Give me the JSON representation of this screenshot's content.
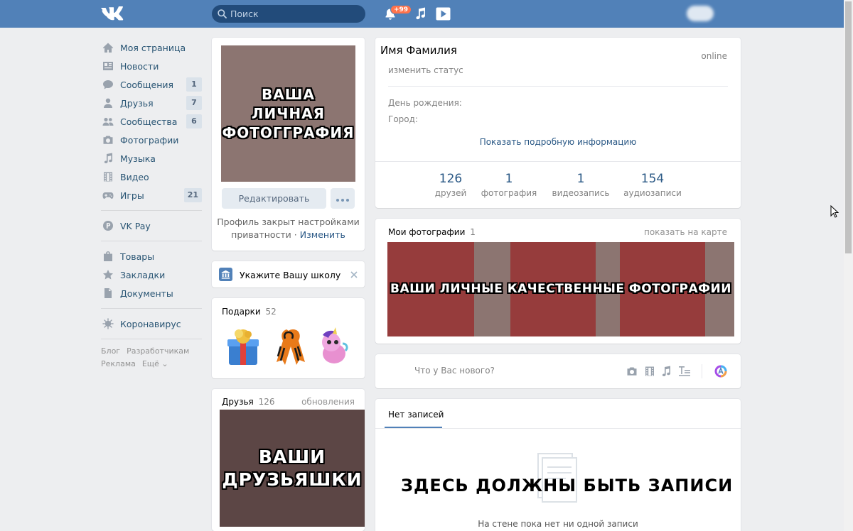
{
  "header": {
    "search_placeholder": "Поиск",
    "notifications_badge": "+99"
  },
  "menu": {
    "items": [
      {
        "label": "Моя страница",
        "icon": "home-icon",
        "count": ""
      },
      {
        "label": "Новости",
        "icon": "news-icon",
        "count": ""
      },
      {
        "label": "Сообщения",
        "icon": "messages-icon",
        "count": "1"
      },
      {
        "label": "Друзья",
        "icon": "friends-icon",
        "count": "7"
      },
      {
        "label": "Сообщества",
        "icon": "communities-icon",
        "count": "6"
      },
      {
        "label": "Фотографии",
        "icon": "camera-icon",
        "count": ""
      },
      {
        "label": "Музыка",
        "icon": "music-icon",
        "count": ""
      },
      {
        "label": "Видео",
        "icon": "video-icon",
        "count": ""
      },
      {
        "label": "Игры",
        "icon": "gamepad-icon",
        "count": "21"
      }
    ],
    "pay": "VK Pay",
    "items2": [
      {
        "label": "Товары",
        "icon": "bag-icon"
      },
      {
        "label": "Закладки",
        "icon": "star-icon"
      },
      {
        "label": "Документы",
        "icon": "document-icon"
      }
    ],
    "covid": "Коронавирус",
    "footer": [
      "Блог",
      "Разработчикам",
      "Реклама",
      "Ещё ⌄"
    ]
  },
  "profile_photo": {
    "caption_lines": [
      "ВАША",
      "ЛИЧНАЯ",
      "ФОТОГГРАФИЯ"
    ],
    "edit_label": "Редактировать",
    "privacy_text": "Профиль закрыт настройками приватности",
    "privacy_sep": "·",
    "privacy_link": "Изменить"
  },
  "school": {
    "label": "Укажите Вашу школу"
  },
  "gifts": {
    "title": "Подарки",
    "count": "52"
  },
  "friends_block": {
    "title": "Друзья",
    "count": "126",
    "updates": "обновления",
    "caption_lines": [
      "ВАШИ",
      "ДРУЗЬЯШКИ"
    ]
  },
  "profile": {
    "name": "Имя Фамилия",
    "online": "online",
    "status": "изменить статус",
    "birthday_label": "День рождения:",
    "city_label": "Город:",
    "more_info": "Показать подробную информацию",
    "stats": [
      {
        "num": "126",
        "label": "друзей"
      },
      {
        "num": "1",
        "label": "фотография"
      },
      {
        "num": "1",
        "label": "видеозапись"
      },
      {
        "num": "154",
        "label": "аудиозаписи"
      }
    ]
  },
  "photos": {
    "title": "Мои фотографии",
    "count": "1",
    "map_link": "показать на карте",
    "caption": "ВАШИ ЛИЧНЫЕ КАЧЕСТВЕННЫЕ ФОТОГРАФИИ"
  },
  "post_box": {
    "placeholder": "Что у Вас нового?"
  },
  "wall": {
    "tab": "Нет записей",
    "overlay": "ЗДЕСЬ ДОЛЖНЫ БЫТЬ ЗАПИСИ",
    "empty_text": "На стене пока нет ни одной записи"
  },
  "colors": {
    "header": "#5181b8",
    "link": "#2a5885",
    "photo_strip_red": "#963c3c",
    "photo_strip_gray": "#8c7571",
    "friends_photo": "#5c4645"
  }
}
